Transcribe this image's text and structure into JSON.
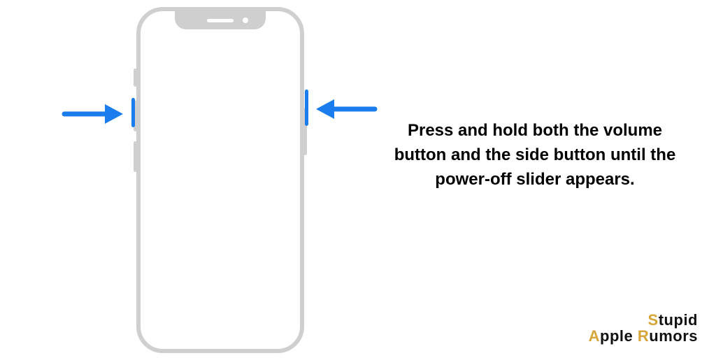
{
  "instruction": "Press and hold both the volume button and the side button until the power-off slider appears.",
  "brand": {
    "line1_accent": "S",
    "line1_rest": "tupid",
    "line2_accent1": "A",
    "line2_word1": "pple ",
    "line2_accent2": "R",
    "line2_word2": "umors"
  },
  "colors": {
    "arrow": "#1b7ced",
    "phone_outline": "#cfcfcf",
    "brand_accent": "#d6a537"
  }
}
